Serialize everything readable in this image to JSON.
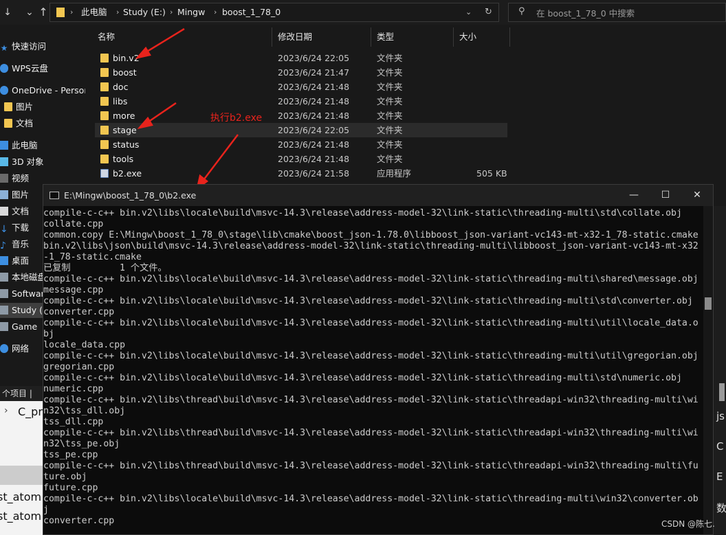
{
  "address": {
    "crumbs": [
      "此电脑",
      "Study (E:)",
      "Mingw",
      "boost_1_78_0"
    ]
  },
  "search": {
    "placeholder": "在 boost_1_78_0 中搜索"
  },
  "nav": {
    "items": [
      {
        "label": "快速访问",
        "icon": "star-icon"
      },
      {
        "label": "WPS云盘",
        "icon": "cloud-icon"
      },
      {
        "label": "OneDrive - Person",
        "icon": "cloud-icon"
      },
      {
        "label": "图片",
        "icon": "folder-icon"
      },
      {
        "label": "文档",
        "icon": "folder-icon"
      },
      {
        "label": "此电脑",
        "icon": "pc-icon"
      },
      {
        "label": "3D 对象",
        "icon": "cube-icon"
      },
      {
        "label": "视频",
        "icon": "video-icon"
      },
      {
        "label": "图片",
        "icon": "picture-icon"
      },
      {
        "label": "文档",
        "icon": "document-icon"
      },
      {
        "label": "下载",
        "icon": "download-icon"
      },
      {
        "label": "音乐",
        "icon": "music-icon"
      },
      {
        "label": "桌面",
        "icon": "desktop-icon"
      },
      {
        "label": "本地磁盘",
        "icon": "drive-icon"
      },
      {
        "label": "Software",
        "icon": "drive-icon"
      },
      {
        "label": "Study (E:)",
        "icon": "drive-icon"
      },
      {
        "label": "Game",
        "icon": "drive-icon"
      },
      {
        "label": "网络",
        "icon": "network-icon"
      }
    ]
  },
  "columns": {
    "name": "名称",
    "date": "修改日期",
    "type": "类型",
    "size": "大小"
  },
  "files": [
    {
      "name": "bin.v2",
      "date": "2023/6/24 22:05",
      "type": "文件夹",
      "size": ""
    },
    {
      "name": "boost",
      "date": "2023/6/24 21:47",
      "type": "文件夹",
      "size": ""
    },
    {
      "name": "doc",
      "date": "2023/6/24 21:48",
      "type": "文件夹",
      "size": ""
    },
    {
      "name": "libs",
      "date": "2023/6/24 21:48",
      "type": "文件夹",
      "size": ""
    },
    {
      "name": "more",
      "date": "2023/6/24 21:48",
      "type": "文件夹",
      "size": ""
    },
    {
      "name": "stage",
      "date": "2023/6/24 22:05",
      "type": "文件夹",
      "size": ""
    },
    {
      "name": "status",
      "date": "2023/6/24 21:48",
      "type": "文件夹",
      "size": ""
    },
    {
      "name": "tools",
      "date": "2023/6/24 21:48",
      "type": "文件夹",
      "size": ""
    },
    {
      "name": "b2.exe",
      "date": "2023/6/24 21:58",
      "type": "应用程序",
      "size": "505 KB"
    }
  ],
  "annotation": "执行b2.exe",
  "status": "个项目  |",
  "background_window": {
    "lines": [
      "C_pr",
      "st_atom",
      "st_atom"
    ]
  },
  "right_edge": {
    "chars": [
      "js",
      "C",
      "E",
      "数"
    ]
  },
  "console": {
    "title": "E:\\Mingw\\boost_1_78_0\\b2.exe",
    "lines": [
      "compile-c-c++ bin.v2\\libs\\locale\\build\\msvc-14.3\\release\\address-model-32\\link-static\\threading-multi\\std\\collate.obj",
      "collate.cpp",
      "common.copy E:\\Mingw\\boost_1_78_0\\stage\\lib\\cmake\\boost_json-1.78.0\\libboost_json-variant-vc143-mt-x32-1_78-static.cmake",
      "bin.v2\\libs\\json\\build\\msvc-14.3\\release\\address-model-32\\link-static\\threading-multi\\libboost_json-variant-vc143-mt-x32",
      "-1_78-static.cmake",
      "已复制         1 个文件。",
      "compile-c-c++ bin.v2\\libs\\locale\\build\\msvc-14.3\\release\\address-model-32\\link-static\\threading-multi\\shared\\message.obj",
      "message.cpp",
      "compile-c-c++ bin.v2\\libs\\locale\\build\\msvc-14.3\\release\\address-model-32\\link-static\\threading-multi\\std\\converter.obj",
      "converter.cpp",
      "compile-c-c++ bin.v2\\libs\\locale\\build\\msvc-14.3\\release\\address-model-32\\link-static\\threading-multi\\util\\locale_data.o",
      "bj",
      "locale_data.cpp",
      "compile-c-c++ bin.v2\\libs\\locale\\build\\msvc-14.3\\release\\address-model-32\\link-static\\threading-multi\\util\\gregorian.obj",
      "gregorian.cpp",
      "compile-c-c++ bin.v2\\libs\\locale\\build\\msvc-14.3\\release\\address-model-32\\link-static\\threading-multi\\std\\numeric.obj",
      "numeric.cpp",
      "compile-c-c++ bin.v2\\libs\\thread\\build\\msvc-14.3\\release\\address-model-32\\link-static\\threadapi-win32\\threading-multi\\wi",
      "n32\\tss_dll.obj",
      "tss_dll.cpp",
      "compile-c-c++ bin.v2\\libs\\thread\\build\\msvc-14.3\\release\\address-model-32\\link-static\\threadapi-win32\\threading-multi\\wi",
      "n32\\tss_pe.obj",
      "tss_pe.cpp",
      "compile-c-c++ bin.v2\\libs\\thread\\build\\msvc-14.3\\release\\address-model-32\\link-static\\threadapi-win32\\threading-multi\\fu",
      "ture.obj",
      "future.cpp",
      "compile-c-c++ bin.v2\\libs\\locale\\build\\msvc-14.3\\release\\address-model-32\\link-static\\threading-multi\\win32\\converter.ob",
      "j",
      "converter.cpp"
    ]
  },
  "watermark": "CSDN @陈七."
}
